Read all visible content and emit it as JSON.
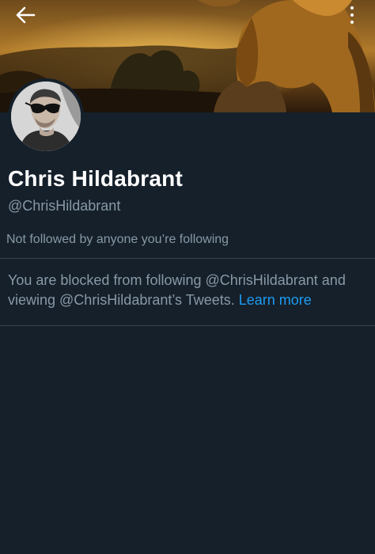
{
  "header": {
    "back_icon": "arrow-left-icon",
    "more_icon": "vertical-ellipsis-icon"
  },
  "profile": {
    "display_name": "Chris Hildabrant",
    "handle": "@ChrisHildabrant",
    "follow_context": "Not followed by anyone you’re following"
  },
  "blocked_notice": {
    "text": "You are blocked from following @ChrisHildabrant and viewing @ChrisHildabrant’s Tweets.",
    "link_label": "Learn more"
  },
  "colors": {
    "background": "#15202b",
    "primary_text": "#ffffff",
    "secondary_text": "#8899a6",
    "link": "#1d9bf0",
    "divider": "#38444d"
  }
}
